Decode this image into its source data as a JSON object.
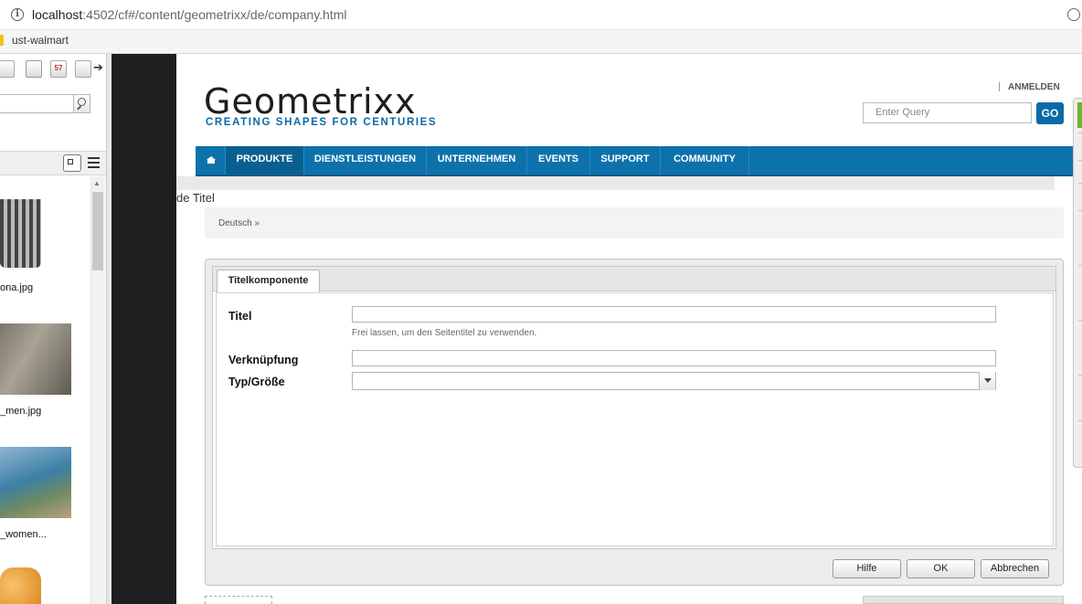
{
  "browser": {
    "url_host": "localhost",
    "url_path": ":4502/cf#/content/geometrixx/de/company.html",
    "bookmark": "ust-walmart"
  },
  "finder": {
    "tabs": [
      "",
      "",
      "57",
      ""
    ],
    "assets": [
      {
        "name": "ona.jpg",
        "color": "#5a5a5a"
      },
      {
        "name": "_men.jpg",
        "color": "#6b6a5c"
      },
      {
        "name": "_women...",
        "color": "#4b86a8"
      },
      {
        "name": "",
        "color": "#e59a3a"
      }
    ]
  },
  "site": {
    "logo": "Geometrixx",
    "tagline": "CREATING SHAPES FOR CENTURIES",
    "login": "ANMELDEN",
    "search_placeholder": "Enter Query",
    "go": "GO",
    "nav": [
      "PRODUKTE",
      "DIENSTLEISTUNGEN",
      "UNTERNEHMEN",
      "EVENTS",
      "SUPPORT",
      "COMMUNITY"
    ],
    "de_title": "de Titel",
    "breadcrumb": "Deutsch »",
    "colors": {
      "brand": "#0d72ac",
      "tagline": "#0b6aa8"
    }
  },
  "dialog": {
    "tab": "Titelkomponente",
    "fields": {
      "title_label": "Titel",
      "title_value": "",
      "title_hint": "Frei lassen, um den Seitentitel zu verwenden.",
      "link_label": "Verknüpfung",
      "link_value": "",
      "type_label": "Typ/Größe",
      "type_value": ""
    },
    "buttons": {
      "help": "Hilfe",
      "ok": "OK",
      "cancel": "Abbrechen"
    }
  }
}
